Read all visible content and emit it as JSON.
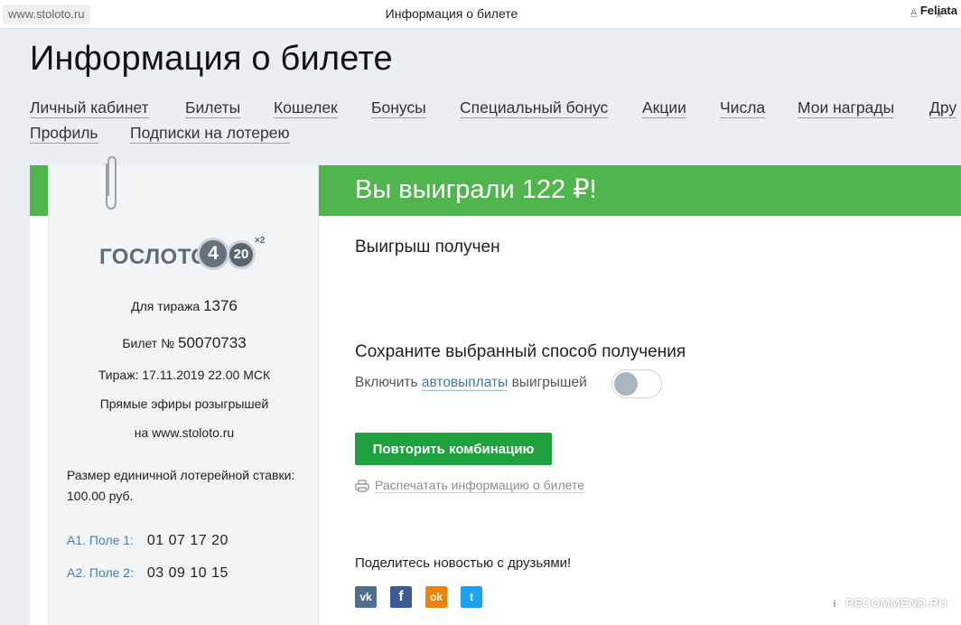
{
  "browser": {
    "url": "www.stoloto.ru",
    "tab_title": "Информация о билете",
    "user": "Feliata",
    "font_icon": "font-size-icon",
    "star_icon": "star-icon"
  },
  "page": {
    "title": "Информация о билете"
  },
  "nav": {
    "row1": [
      {
        "label": "Личный кабинет"
      },
      {
        "label": "Билеты"
      },
      {
        "label": "Кошелек"
      },
      {
        "label": "Бонусы"
      },
      {
        "label": "Специальный бонус"
      },
      {
        "label": "Акции"
      },
      {
        "label": "Числа"
      },
      {
        "label": "Мои награды"
      },
      {
        "label": "Дру"
      }
    ],
    "row2": [
      {
        "label": "Профиль"
      },
      {
        "label": "Подписки на лотерею"
      }
    ]
  },
  "ticket": {
    "logo_text": "ГОСЛОТО",
    "logo_ball_1": "4",
    "logo_ball_2": "20",
    "logo_mult": "×2",
    "draw_label": "Для тиража",
    "draw_number": "1376",
    "ticket_label": "Билет №",
    "ticket_number": "50070733",
    "draw_date": "Тираж: 17.11.2019 22.00 МСК",
    "live_line1": "Прямые эфиры розыгрышей",
    "live_line2": "на www.stoloto.ru",
    "stake_line1": "Размер единичной лотерейной ставки:",
    "stake_line2": "100.00 руб.",
    "fields": [
      {
        "label": "А1. Поле 1:",
        "numbers": "01 07 17 20"
      },
      {
        "label": "А2. Поле 2:",
        "numbers": "03 09 10 15"
      }
    ]
  },
  "result": {
    "win_title": "Вы выиграли 122 ₽!",
    "status": "Выигрыш получен",
    "save_title": "Сохраните выбранный способ получения",
    "auto_prefix": "Включить",
    "auto_link": "автовыплаты",
    "auto_suffix": "выигрышей",
    "autopay_enabled": false,
    "repeat_button": "Повторить комбинацию",
    "print_link": "Распечатать информацию о билете",
    "share_title": "Поделитесь новостью с друзьями!",
    "social": [
      {
        "name": "vk-icon",
        "glyph": "vk"
      },
      {
        "name": "facebook-icon",
        "glyph": "f"
      },
      {
        "name": "odnoklassniki-icon",
        "glyph": "ok"
      },
      {
        "name": "twitter-icon",
        "glyph": "t"
      }
    ]
  },
  "colors": {
    "green_band": "#4fb64d",
    "button": "#1da23d",
    "link": "#3a7ab8"
  },
  "watermark": "RECOMMEND.RU"
}
